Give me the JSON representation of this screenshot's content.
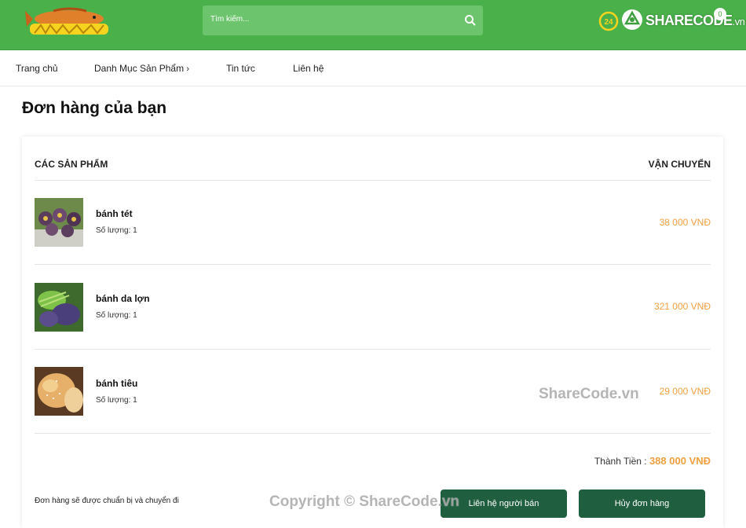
{
  "header": {
    "search_placeholder": "Tìm kiếm...",
    "brand": "SHARECODE",
    "brand_suffix": ".vn",
    "support_badge": "24",
    "cart_count": "0"
  },
  "nav": {
    "items": [
      {
        "label": "Trang chủ"
      },
      {
        "label": "Danh Mục Sản Phẩm"
      },
      {
        "label": "Tin tức"
      },
      {
        "label": "Liên hệ"
      }
    ]
  },
  "page": {
    "title": "Đơn hàng của bạn"
  },
  "order": {
    "col_products": "CÁC SẢN PHẨM",
    "col_shipping": "VẬN CHUYỂN",
    "items": [
      {
        "name": "bánh tét",
        "qty": "Số lượng: 1",
        "price": "38 000 VNĐ"
      },
      {
        "name": "bánh da lợn",
        "qty": "Số lượng: 1",
        "price": "321 000 VNĐ"
      },
      {
        "name": "bánh tiêu",
        "qty": "Số lượng: 1",
        "price": "29 000 VNĐ"
      }
    ],
    "total_label": "Thành Tiền :",
    "total_value": "388 000 VNĐ",
    "note": "Đơn hàng sẽ được chuẩn bị và chuyển đi",
    "contact_button": "Liên hệ người bán",
    "cancel_button": "Hủy đơn hàng"
  },
  "watermarks": {
    "center": "ShareCode.vn",
    "bottom": "Copyright © ShareCode.vn"
  },
  "colors": {
    "header_green": "#4ab04a",
    "price_orange": "#f0a040",
    "button_green": "#1f5e3f"
  }
}
